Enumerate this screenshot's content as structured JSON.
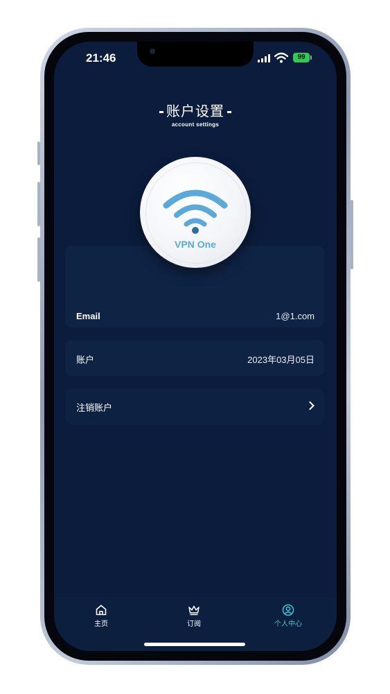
{
  "status_bar": {
    "time": "21:46",
    "battery": "99"
  },
  "header": {
    "title": "账户设置",
    "subtitle": "account settings"
  },
  "logo": {
    "text": "VPN One",
    "icon": "wifi-icon"
  },
  "rows": {
    "email": {
      "label": "Email",
      "value": "1@1.com"
    },
    "account": {
      "label": "账户",
      "value": "2023年03月05日"
    },
    "delete": {
      "label": "注销账户",
      "icon": "chevron-right-icon"
    }
  },
  "tabs": [
    {
      "label": "主页",
      "icon": "home-icon"
    },
    {
      "label": "订阅",
      "icon": "crown-icon"
    },
    {
      "label": "个人中心",
      "icon": "user-icon"
    }
  ],
  "colors": {
    "background": "#0b1c3c",
    "card": "#0f2345",
    "accent": "#3ec7d3",
    "logo_blue": "#5aa9d8"
  }
}
